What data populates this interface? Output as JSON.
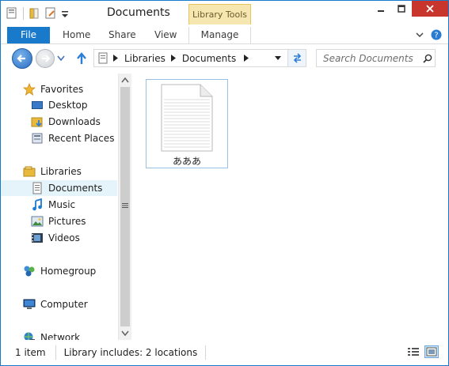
{
  "window": {
    "title": "Documents",
    "context_tab": "Library Tools"
  },
  "ribbon": {
    "file_label": "File",
    "tabs": [
      "Home",
      "Share",
      "View"
    ],
    "manage_label": "Manage"
  },
  "address": {
    "crumbs": [
      "Libraries",
      "Documents"
    ]
  },
  "search": {
    "placeholder": "Search Documents"
  },
  "nav": {
    "favorites": "Favorites",
    "desktop": "Desktop",
    "downloads": "Downloads",
    "recent": "Recent Places",
    "libraries": "Libraries",
    "documents": "Documents",
    "music": "Music",
    "pictures": "Pictures",
    "videos": "Videos",
    "homegroup": "Homegroup",
    "computer": "Computer",
    "network": "Network"
  },
  "files": [
    {
      "name": "あああ"
    }
  ],
  "status": {
    "count": "1 item",
    "library": "Library includes: 2 locations"
  },
  "colors": {
    "accent": "#1979ca",
    "selection": "#e5f3fb",
    "context_tab": "#f6e7b0"
  }
}
